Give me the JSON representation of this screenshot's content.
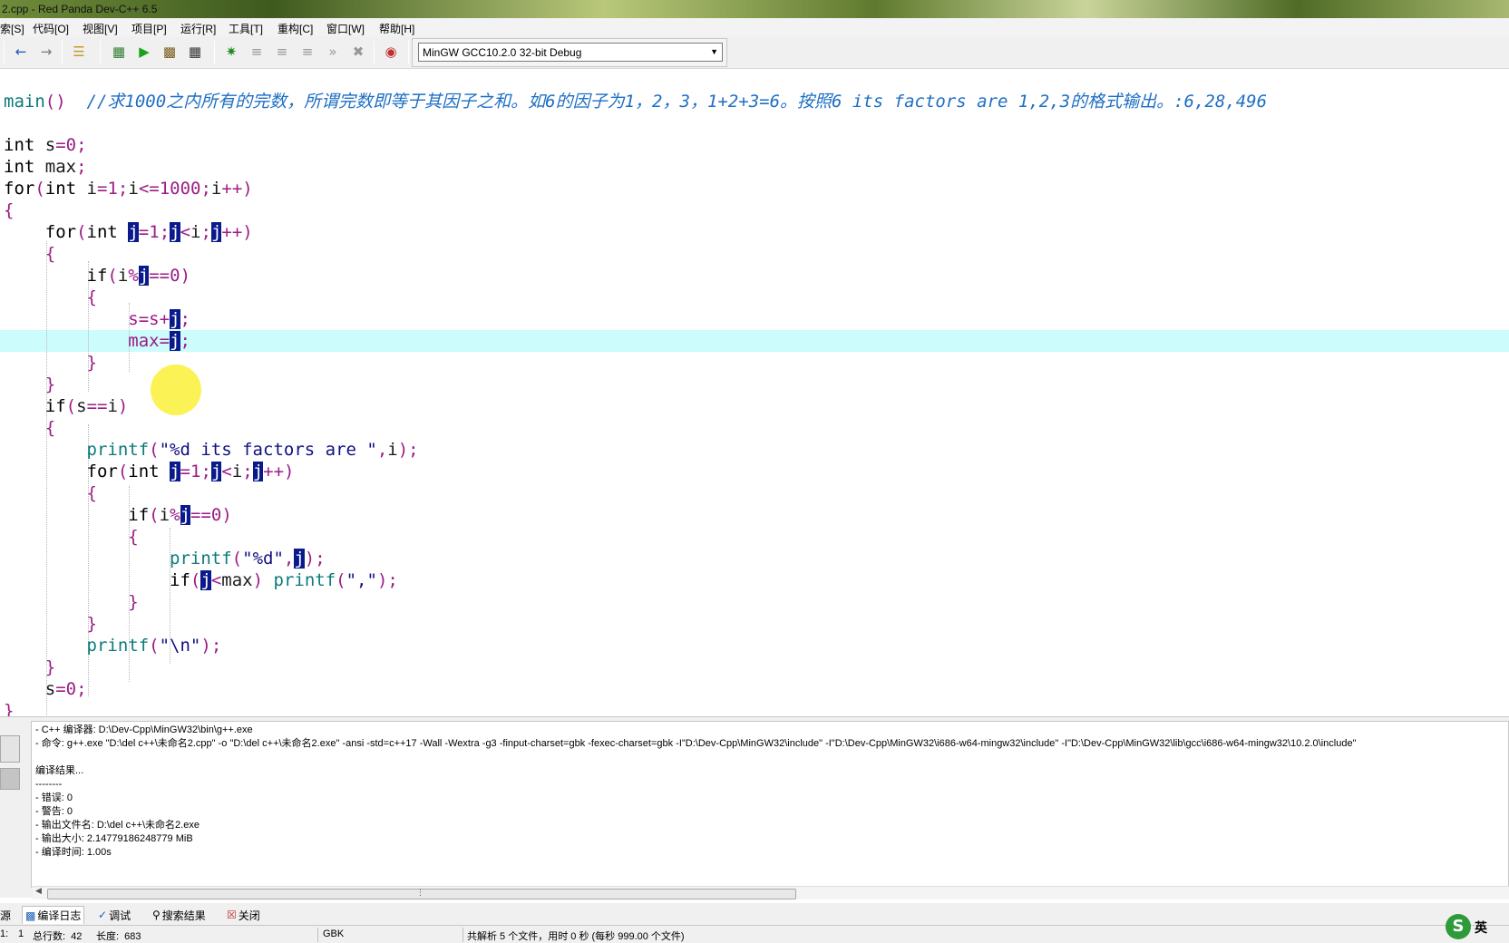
{
  "window": {
    "title": "2.cpp - Red Panda Dev-C++ 6.5"
  },
  "menu": [
    "索[S]",
    "代码[O]",
    "视图[V]",
    "项目[P]",
    "运行[R]",
    "工具[T]",
    "重构[C]",
    "窗口[W]",
    "帮助[H]"
  ],
  "toolbar": {
    "compiler": "MinGW GCC10.2.0 32-bit Debug",
    "icons": [
      "back-icon",
      "forward-icon",
      "list-icon",
      "compile-icon",
      "run-icon",
      "compile-run-icon",
      "rebuild-icon",
      "debug-icon",
      "step-over-icon",
      "step-into-icon",
      "step-out-icon",
      "continue-icon",
      "stop-icon",
      "watch-icon"
    ]
  },
  "code": [
    "main()  //求1000之内所有的完数，所谓完数即等于其因子之和。如6的因子为1，2，3，1+2+3=6。按照6 its factors are 1,2,3的格式输出。:6,28,496",
    "",
    "int s=0;",
    "int max;",
    "for(int i=1;i<=1000;i++)",
    "{",
    "    for(int j=1;j<i;j++)",
    "    {",
    "        if(i%j==0)",
    "        {",
    "            s=s+j;",
    "            max=j;",
    "        }",
    "    }",
    "    if(s==i)",
    "    {",
    "        printf(\"%d its factors are \",i);",
    "        for(int j=1;j<i;j++)",
    "        {",
    "            if(i%j==0)",
    "            {",
    "                printf(\"%d\",j);",
    "                if(j<max) printf(\",\");",
    "            }",
    "        }",
    "        printf(\"\\n\");",
    "    }",
    "    s=0;",
    "}"
  ],
  "compile_log": [
    "- C++ 编译器: D:\\Dev-Cpp\\MinGW32\\bin\\g++.exe",
    "- 命令: g++.exe \"D:\\del c++\\未命名2.cpp\" -o \"D:\\del c++\\未命名2.exe\" -ansi -std=c++17 -Wall -Wextra -g3 -finput-charset=gbk -fexec-charset=gbk -I\"D:\\Dev-Cpp\\MinGW32\\include\" -I\"D:\\Dev-Cpp\\MinGW32\\i686-w64-mingw32\\include\" -I\"D:\\Dev-Cpp\\MinGW32\\lib\\gcc\\i686-w64-mingw32\\10.2.0\\include\"",
    "",
    "编译结果...",
    "--------",
    "- 错误: 0",
    "- 警告: 0",
    "- 输出文件名: D:\\del c++\\未命名2.exe",
    "- 输出大小: 2.14779186248779 MiB",
    "- 编译时间: 1.00s"
  ],
  "tabs": [
    {
      "label": "源",
      "icon": ""
    },
    {
      "label": "编译日志",
      "icon": "chart-icon"
    },
    {
      "label": "调试",
      "icon": "debug-icon"
    },
    {
      "label": "搜索结果",
      "icon": "search-icon"
    },
    {
      "label": "关闭",
      "icon": "close-icon"
    }
  ],
  "status": {
    "line_label": "1:",
    "line_value": "1",
    "total_lines": "总行数:  42",
    "length": "长度:  683",
    "encoding": "GBK",
    "parse_info": "共解析 5 个文件，用时 0 秒 (每秒 999.00 个文件)"
  },
  "ime": {
    "logo": "S",
    "lang": "英"
  }
}
